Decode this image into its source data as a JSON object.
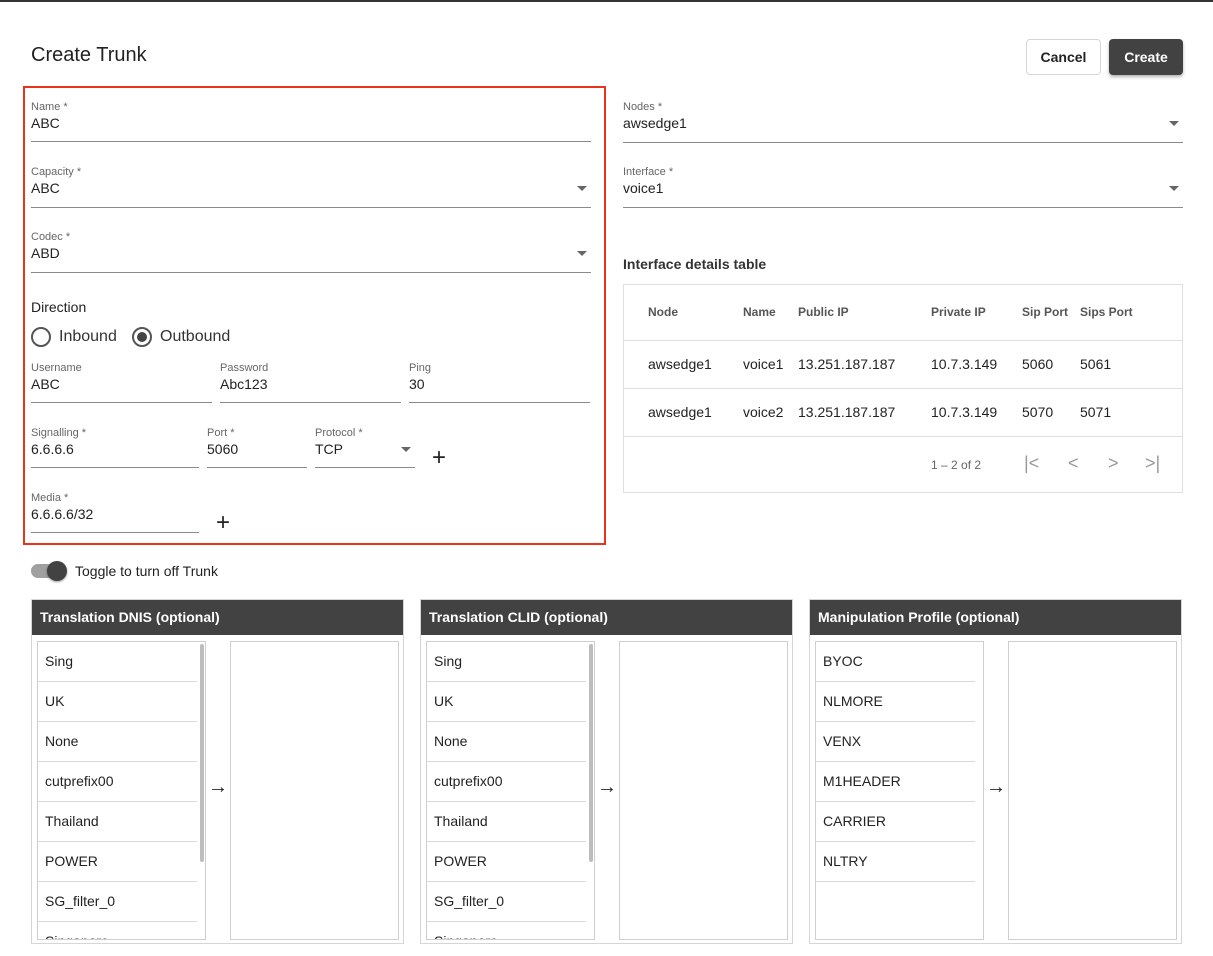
{
  "header": {
    "title": "Create Trunk",
    "cancel_label": "Cancel",
    "create_label": "Create"
  },
  "form": {
    "name": {
      "label": "Name *",
      "value": "ABC"
    },
    "capacity": {
      "label": "Capacity *",
      "value": "ABC"
    },
    "codec": {
      "label": "Codec *",
      "value": "ABD"
    },
    "direction": {
      "label": "Direction",
      "inbound": "Inbound",
      "outbound": "Outbound",
      "selected": "Outbound"
    },
    "username": {
      "label": "Username",
      "value": "ABC"
    },
    "password": {
      "label": "Password",
      "value": "Abc123"
    },
    "ping": {
      "label": "Ping",
      "value": "30"
    },
    "signalling": {
      "label": "Signalling *",
      "value": "6.6.6.6"
    },
    "port": {
      "label": "Port *",
      "value": "5060"
    },
    "protocol": {
      "label": "Protocol *",
      "value": "TCP"
    },
    "media": {
      "label": "Media *",
      "value": "6.6.6.6/32"
    },
    "add_symbol": "+"
  },
  "nodes": {
    "label": "Nodes *",
    "value": "awsedge1"
  },
  "interface": {
    "label": "Interface *",
    "value": "voice1"
  },
  "interface_table": {
    "title": "Interface details table",
    "headers": [
      "Node",
      "Name",
      "Public IP",
      "Private IP",
      "Sip Port",
      "Sips Port"
    ],
    "rows": [
      [
        "awsedge1",
        "voice1",
        "13.251.187.187",
        "10.7.3.149",
        "5060",
        "5061"
      ],
      [
        "awsedge1",
        "voice2",
        "13.251.187.187",
        "10.7.3.149",
        "5070",
        "5071"
      ]
    ],
    "pager_text": "1 – 2 of 2",
    "pager_icons": [
      "first-page-icon",
      "prev-page-icon",
      "next-page-icon",
      "last-page-icon"
    ]
  },
  "toggle": {
    "label": "Toggle to turn off Trunk",
    "on": true
  },
  "panels": [
    {
      "title": "Translation DNIS (optional)",
      "items": [
        "Sing",
        "UK",
        "None",
        "cutprefix00",
        "Thailand",
        "POWER",
        "SG_filter_0",
        "Singapore"
      ]
    },
    {
      "title": "Translation CLID (optional)",
      "items": [
        "Sing",
        "UK",
        "None",
        "cutprefix00",
        "Thailand",
        "POWER",
        "SG_filter_0",
        "Singapore"
      ]
    },
    {
      "title": "Manipulation Profile (optional)",
      "items": [
        "BYOC",
        "NLMORE",
        "VENX",
        "M1HEADER",
        "CARRIER",
        "NLTRY"
      ]
    }
  ],
  "arrow_symbol": "→",
  "colors": {
    "highlight": "#e8341c",
    "header_bg": "#424242"
  }
}
